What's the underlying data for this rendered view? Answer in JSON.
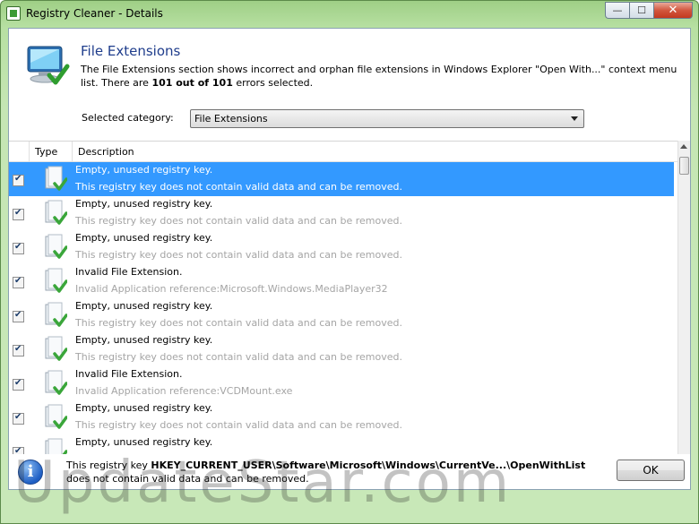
{
  "window": {
    "title": "Registry Cleaner - Details",
    "minimize": "—",
    "maximize": "☐",
    "close": "✕"
  },
  "header": {
    "title": "File Extensions",
    "description_part1": "The File Extensions section shows incorrect and orphan file extensions in Windows Explorer \"Open With...\" context menu list. There are ",
    "description_count": "101 out of 101",
    "description_part2": " errors selected."
  },
  "category": {
    "label": "Selected category:",
    "value": "File Extensions"
  },
  "list": {
    "columns": [
      "Type",
      "Description"
    ],
    "rows": [
      {
        "checked": true,
        "selected": true,
        "title": "Empty, unused registry key.",
        "detail": "This registry key does not contain valid data and can be removed."
      },
      {
        "checked": true,
        "selected": false,
        "title": "Empty, unused registry key.",
        "detail": "This registry key does not contain valid data and can be removed."
      },
      {
        "checked": true,
        "selected": false,
        "title": "Empty, unused registry key.",
        "detail": "This registry key does not contain valid data and can be removed."
      },
      {
        "checked": true,
        "selected": false,
        "title": "Invalid File Extension.",
        "detail": "Invalid Application reference:Microsoft.Windows.MediaPlayer32"
      },
      {
        "checked": true,
        "selected": false,
        "title": "Empty, unused registry key.",
        "detail": "This registry key does not contain valid data and can be removed."
      },
      {
        "checked": true,
        "selected": false,
        "title": "Empty, unused registry key.",
        "detail": "This registry key does not contain valid data and can be removed."
      },
      {
        "checked": true,
        "selected": false,
        "title": "Invalid File Extension.",
        "detail": "Invalid Application reference:VCDMount.exe"
      },
      {
        "checked": true,
        "selected": false,
        "title": "Empty, unused registry key.",
        "detail": "This registry key does not contain valid data and can be removed."
      },
      {
        "checked": true,
        "selected": false,
        "title": "Empty, unused registry key.",
        "detail": "This registry key does not contain valid data and can be removed."
      }
    ]
  },
  "status": {
    "prefix": "This registry key ",
    "key": "HKEY_CURRENT_USER\\Software\\Microsoft\\Windows\\CurrentVe...\\OpenWithList",
    "suffix": " does not contain valid data and can be removed."
  },
  "buttons": {
    "ok": "OK"
  },
  "watermark": "UpdateStar.com",
  "colors": {
    "selection": "#3399ff",
    "title_blue": "#1f3d8c",
    "frame_green": "#b7e0a2"
  }
}
